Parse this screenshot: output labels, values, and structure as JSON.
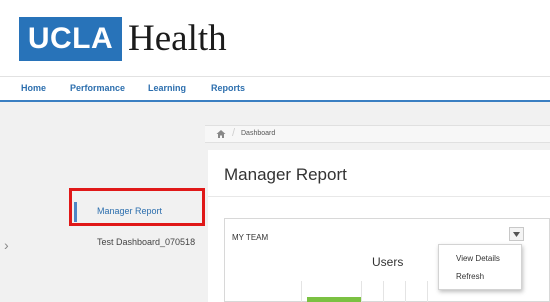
{
  "header": {
    "logo_ucla": "UCLA",
    "logo_health": "Health"
  },
  "nav": {
    "items": [
      "Home",
      "Performance",
      "Learning",
      "Reports"
    ]
  },
  "sidebar": {
    "items": [
      {
        "label": "Manager Report",
        "active": true
      },
      {
        "label": "Test Dashboard_070518",
        "active": false
      }
    ]
  },
  "breadcrumb": {
    "current": "Dashboard"
  },
  "main": {
    "title": "Manager Report",
    "card": {
      "title": "MY TEAM",
      "chart_title": "Users"
    },
    "menu": {
      "items": [
        "View Details",
        "Refresh"
      ]
    }
  },
  "colors": {
    "brand_blue": "#2873b9",
    "nav_link": "#2d6fae",
    "highlight_red": "#e01818",
    "bar_green": "#7bc142"
  }
}
